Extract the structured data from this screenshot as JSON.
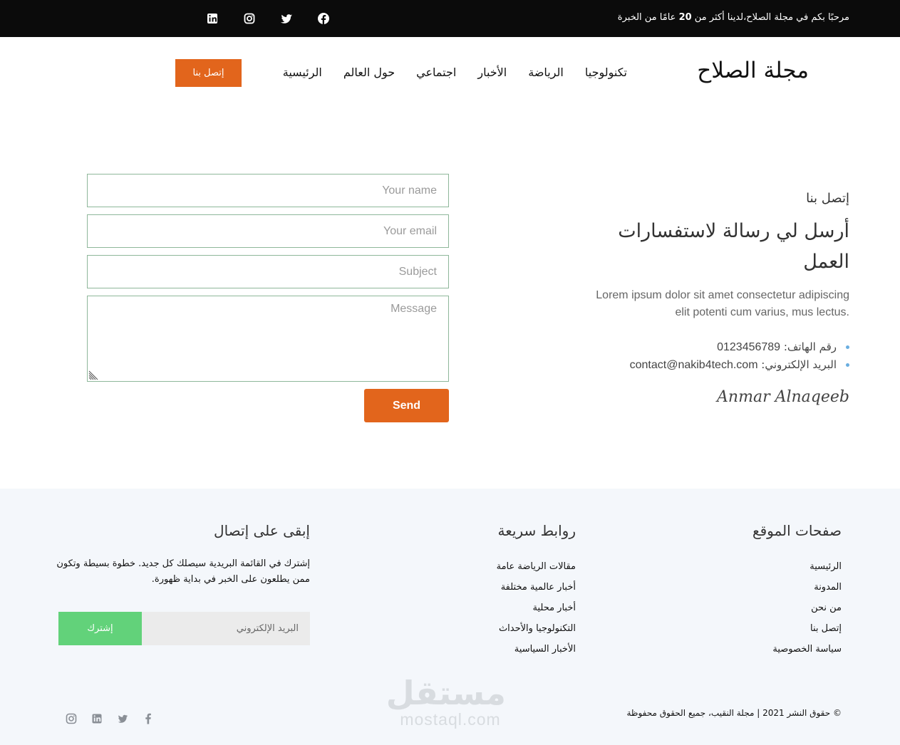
{
  "topbar": {
    "welcome_prefix": "مرحبًا بكم في مجلة الصلاح،لدينا أكثر من ",
    "welcome_years": "20",
    "welcome_suffix": " عامًا من الخبرة",
    "social": [
      "facebook-icon",
      "twitter-icon",
      "instagram-icon",
      "linkedin-icon"
    ]
  },
  "header": {
    "site_title": "مجلة الصلاح",
    "nav": [
      "الرئيسية",
      "حول العالم",
      "اجتماعي",
      "الأخبار",
      "الرياضة",
      "تكنولوجيا"
    ],
    "cta": "إتصل بنا",
    "accent": "#e2651c"
  },
  "contact": {
    "eyebrow": "إتصل بنا",
    "heading": "أرسل لي رسالة لاستفسارات العمل",
    "lead": "Lorem ipsum dolor sit amet consectetur adipiscing elit potenti cum varius, mus lectus.",
    "phone_label": "رقم الهاتف: ",
    "phone": "0123456789",
    "email_label": "البريد الإلكتروني: ",
    "email": "contact@nakib4tech.com",
    "signature": "Anmar Alnaqeeb"
  },
  "form": {
    "name_placeholder": "Your name",
    "email_placeholder": "Your email",
    "subject_placeholder": "Subject",
    "message_placeholder": "Message",
    "send_label": "Send"
  },
  "footer": {
    "pages_title": "صفحات الموقع",
    "pages": [
      "الرئيسية",
      "المدونة",
      "من نحن",
      "إتصل بنا",
      "سياسة الخصوصية"
    ],
    "links_title": "روابط سريعة",
    "links": [
      "مقالات الرياضة عامة",
      "أخبار عالمية مختلفة",
      "أخبار محلية",
      "التكنولوجيا والأحداث",
      "الأخبار السياسية"
    ],
    "newsletter_title": "إبقى على إتصال",
    "newsletter_text": "إشترك في القائمة البريدية سيصلك كل جديد. خطوة بسيطة وتكون ممن يطلعون على الخبر في بداية ظهورة.",
    "email_placeholder": "البريد الإلكتروني",
    "subscribe_label": "إشترك",
    "subscribe_color": "#62d27a",
    "copyright": "© حقوق النشر 2021 | مجلة النقيب، جميع الحقوق محفوظة",
    "social": [
      "facebook-icon",
      "twitter-icon",
      "linkedin-icon",
      "instagram-icon"
    ],
    "watermark_ar": "مستقل",
    "watermark_lat": "mostaql.com"
  }
}
